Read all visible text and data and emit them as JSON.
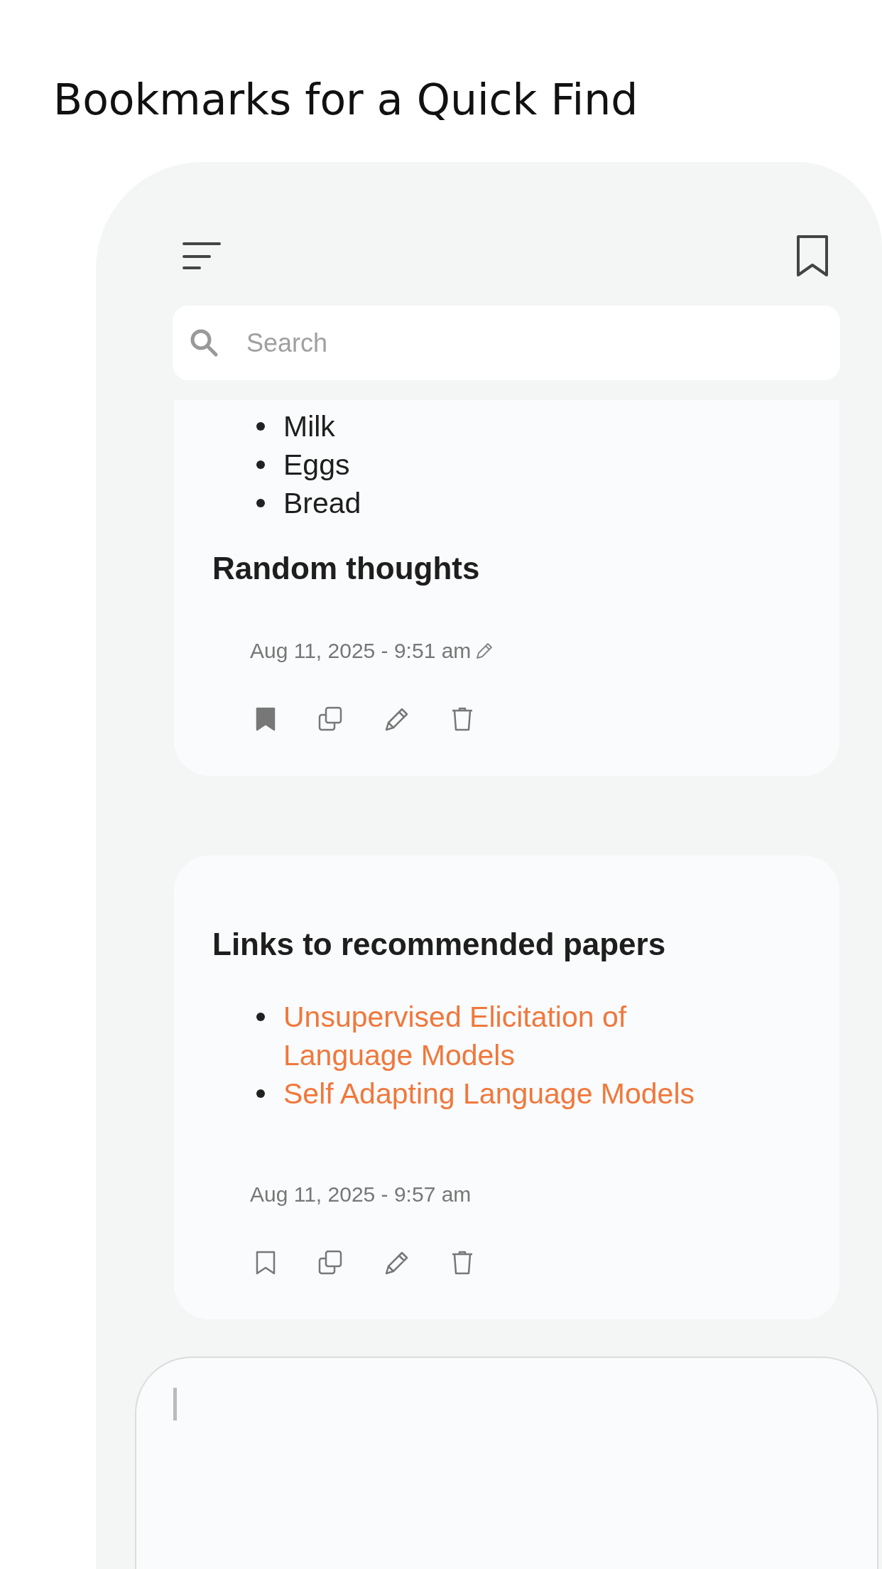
{
  "heading": "Bookmarks for a Quick Find",
  "search": {
    "placeholder": "Search"
  },
  "notes": [
    {
      "title": "Random thoughts",
      "items_before_title": [
        {
          "kind": "text",
          "text": "Milk"
        },
        {
          "kind": "text",
          "text": "Eggs"
        },
        {
          "kind": "text",
          "text": "Bread"
        }
      ],
      "date": "Aug 11, 2025 - 9:51 am",
      "edited": true,
      "bookmarked": true
    },
    {
      "title": "Links to recommended papers",
      "items": [
        {
          "kind": "link",
          "text": "Unsupervised Elicitation of Language Models"
        },
        {
          "kind": "link",
          "text": "Self Adapting Language Models"
        }
      ],
      "date": "Aug 11, 2025 - 9:57 am",
      "edited": false,
      "bookmarked": false
    }
  ],
  "composer": {
    "focused": true
  }
}
